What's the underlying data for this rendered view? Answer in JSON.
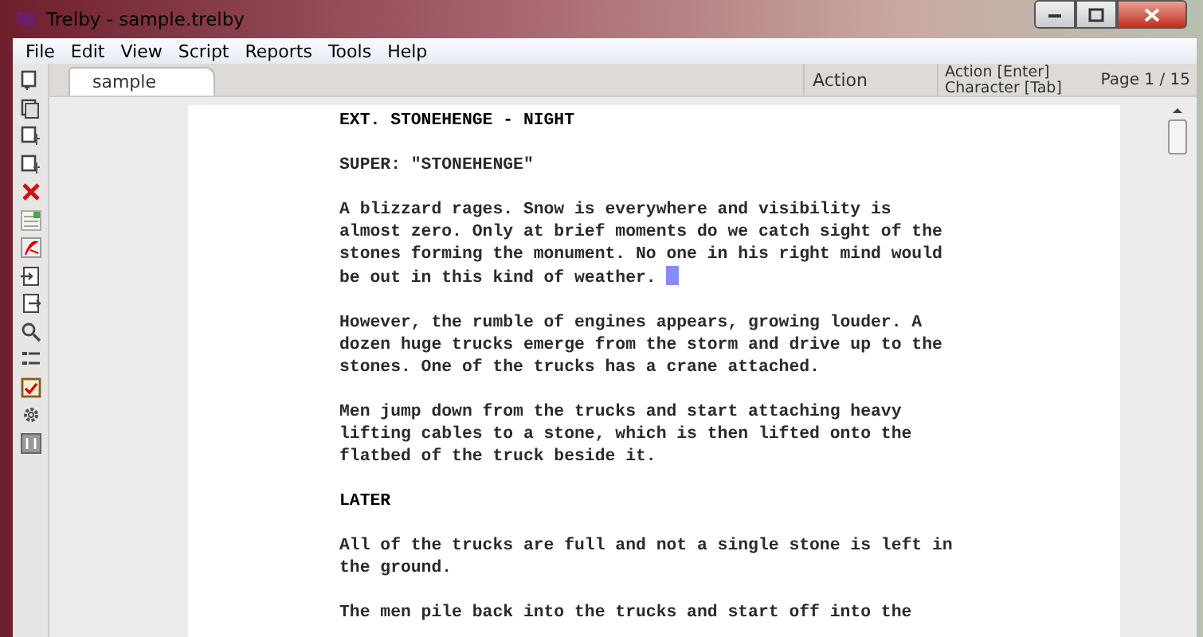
{
  "window": {
    "title": "Trelby - sample.trelby"
  },
  "menu": [
    "File",
    "Edit",
    "View",
    "Script",
    "Reports",
    "Tools",
    "Help"
  ],
  "tabs": [
    {
      "label": "sample",
      "selected": true
    }
  ],
  "status": {
    "element": "Action",
    "hints": [
      "Action [Enter]",
      "Character [Tab]"
    ],
    "page": "Page 1 / 15"
  },
  "script": [
    {
      "kind": "scene",
      "lines": [
        "EXT. STONEHENGE - NIGHT"
      ],
      "has_cursor": false
    },
    {
      "kind": "action",
      "lines": [
        "SUPER: \"STONEHENGE\""
      ],
      "has_cursor": false
    },
    {
      "kind": "action",
      "lines": [
        "A blizzard rages. Snow is everywhere and visibility is",
        "almost zero. Only at brief moments do we catch sight of the",
        "stones forming the monument. No one in his right mind would",
        "be out in this kind of weather."
      ],
      "has_cursor": true
    },
    {
      "kind": "action",
      "lines": [
        "However, the rumble of engines appears, growing louder. A",
        "dozen huge trucks emerge from the storm and drive up to the",
        "stones. One of the trucks has a crane attached."
      ],
      "has_cursor": false
    },
    {
      "kind": "action",
      "lines": [
        "Men jump down from the trucks and start attaching heavy",
        "lifting cables to a stone, which is then lifted onto the",
        "flatbed of the truck beside it."
      ],
      "has_cursor": false
    },
    {
      "kind": "scene",
      "lines": [
        "LATER"
      ],
      "has_cursor": false
    },
    {
      "kind": "action",
      "lines": [
        "All of the trucks are full and not a single stone is left in",
        "the ground."
      ],
      "has_cursor": false
    },
    {
      "kind": "action",
      "lines": [
        "The men pile back into the trucks and start off into the"
      ],
      "has_cursor": false
    }
  ]
}
